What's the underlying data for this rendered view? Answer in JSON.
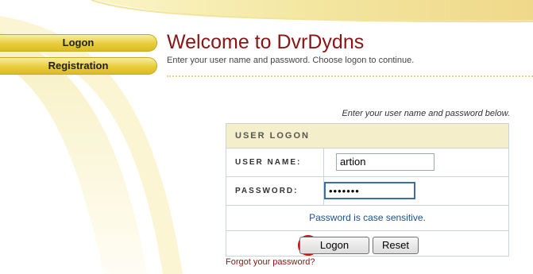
{
  "sidebar": {
    "items": [
      {
        "label": "Logon"
      },
      {
        "label": "Registration"
      }
    ]
  },
  "header": {
    "title": "Welcome to DvrDydns",
    "subtitle": "Enter your user name and password. Choose logon to continue."
  },
  "form": {
    "hint": "Enter your user name and password below.",
    "heading": "USER LOGON",
    "username_label": "USER NAME:",
    "username_value": "artion",
    "password_label": "PASSWORD:",
    "password_value": "•••••••",
    "note": "Password is case sensitive.",
    "logon_label": "Logon",
    "reset_label": "Reset",
    "marker": "1",
    "forgot": "Forgot your password?"
  },
  "colors": {
    "accent": "#8a1515",
    "button_gold": "#e8cc3c",
    "panel_head": "#f5eecb"
  }
}
